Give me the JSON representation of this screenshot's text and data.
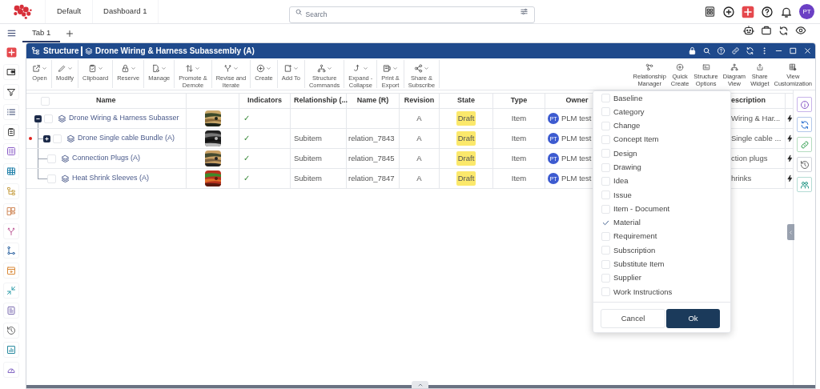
{
  "top_bar": {
    "tabs": [
      {
        "label": "Default"
      },
      {
        "label": "Dashboard 1"
      }
    ],
    "search": {
      "placeholder": "Search"
    },
    "avatar": "PT"
  },
  "workspace_tabs": [
    {
      "label": "Tab 1",
      "selected": true
    }
  ],
  "widget": {
    "title": "Structure",
    "object": "Drone Wiring & Harness Subassembly (A)",
    "commands": [
      {
        "label": "Open"
      },
      {
        "label": "Modify"
      },
      {
        "label": "Clipboard"
      },
      {
        "label": "Reserve"
      },
      {
        "label": "Manage"
      },
      {
        "label": "Promote &\nDemote"
      },
      {
        "label": "Revise and\nIterate"
      },
      {
        "label": "Create"
      },
      {
        "label": "Add To"
      },
      {
        "label": "Structure\nCommands"
      },
      {
        "label": "Expand -\nCollapse"
      },
      {
        "label": "Print &\nExport"
      },
      {
        "label": "Share &\nSubscribe"
      }
    ],
    "views": [
      {
        "label": "Relationship\nManager"
      },
      {
        "label": "Quick\nCreate"
      },
      {
        "label": "Structure\nOptions"
      },
      {
        "label": "Diagram\nView"
      },
      {
        "label": "Share\nWidget"
      },
      {
        "label": "View\nCustomization"
      }
    ]
  },
  "table": {
    "all_checked": false,
    "columns": [
      "Name",
      "Indicators",
      "Relationship (...",
      "Name (R)",
      "Revision",
      "State",
      "Type",
      "Owner",
      "escription"
    ],
    "rows": [
      {
        "name": "Drone Wiring & Harness Subasser",
        "expanded": true,
        "checked": false,
        "indicators": "✓",
        "revision": "A",
        "state": "Draft",
        "type": "Item",
        "owner": {
          "initials": "PT",
          "name": "PLM test"
        },
        "description": "Wiring & Har...",
        "children": [
          {
            "name": "Drone Single cable Bundle (A)",
            "expanded": false,
            "marked": true,
            "checked": false,
            "indicators": "✓",
            "relationship": "Subitem",
            "name_r": "relation_7843",
            "revision": "A",
            "state": "Draft",
            "type": "Item",
            "owner": {
              "initials": "PT",
              "name": "PLM test"
            },
            "description": "Single cable ..."
          },
          {
            "name": "Connection Plugs (A)",
            "checked": false,
            "indicators": "✓",
            "relationship": "Subitem",
            "name_r": "relation_7845",
            "revision": "A",
            "state": "Draft",
            "type": "Item",
            "owner": {
              "initials": "PT",
              "name": "PLM test"
            },
            "description": "ction plugs"
          },
          {
            "name": "Heat Shrink Sleeves (A)",
            "checked": false,
            "indicators": "✓",
            "relationship": "Subitem",
            "name_r": "relation_7847",
            "revision": "A",
            "state": "Draft",
            "type": "Item",
            "owner": {
              "initials": "PT",
              "name": "PLM test"
            },
            "description": "hrinks"
          }
        ]
      }
    ]
  },
  "relationship_filter": {
    "options": [
      {
        "label": "Baseline",
        "checked": false
      },
      {
        "label": "Category",
        "checked": false
      },
      {
        "label": "Change",
        "checked": false
      },
      {
        "label": "Concept Item",
        "checked": false
      },
      {
        "label": "Design",
        "checked": false
      },
      {
        "label": "Drawing",
        "checked": false
      },
      {
        "label": "Idea",
        "checked": false
      },
      {
        "label": "Issue",
        "checked": false
      },
      {
        "label": "Item - Document",
        "checked": false
      },
      {
        "label": "Material",
        "checked": true
      },
      {
        "label": "Requirement",
        "checked": false
      },
      {
        "label": "Subscription",
        "checked": false
      },
      {
        "label": "Substitute Item",
        "checked": false
      },
      {
        "label": "Supplier",
        "checked": false
      },
      {
        "label": "Work Instructions",
        "checked": false
      }
    ],
    "buttons": [
      {
        "label": "Cancel",
        "kind": "secondary"
      },
      {
        "label": "Ok",
        "kind": "primary"
      }
    ]
  }
}
